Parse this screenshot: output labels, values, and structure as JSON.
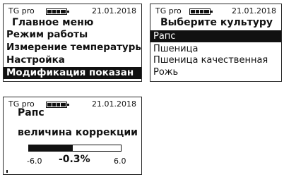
{
  "screens": [
    {
      "status": {
        "device": "TG pro",
        "date": "21.01.2018",
        "battery_level": 0.95
      },
      "menu": {
        "title": "Главное меню",
        "items": [
          {
            "label": "Режим работы"
          },
          {
            "label": "Измерение температуры"
          },
          {
            "label": "Настройка"
          },
          {
            "label": "Модификация показан",
            "selected": true
          }
        ]
      }
    },
    {
      "status": {
        "device": "TG pro",
        "date": "21.01.2018",
        "battery_level": 0.95
      },
      "menu": {
        "title": "Выберите культуру",
        "items": [
          {
            "label": "Рапс",
            "selected": true
          },
          {
            "label": "Пшеница"
          },
          {
            "label": "Пшеница качественная"
          },
          {
            "label": "Рожь"
          }
        ]
      }
    },
    {
      "status": {
        "device": "TG pro",
        "date": "21.01.2018",
        "battery_level": 0.95
      },
      "crop": "Рапс",
      "title": "величина коррекции",
      "correction": {
        "min": "-6.0",
        "max": "6.0",
        "value": "-0.3%",
        "level": 0.48
      }
    }
  ]
}
